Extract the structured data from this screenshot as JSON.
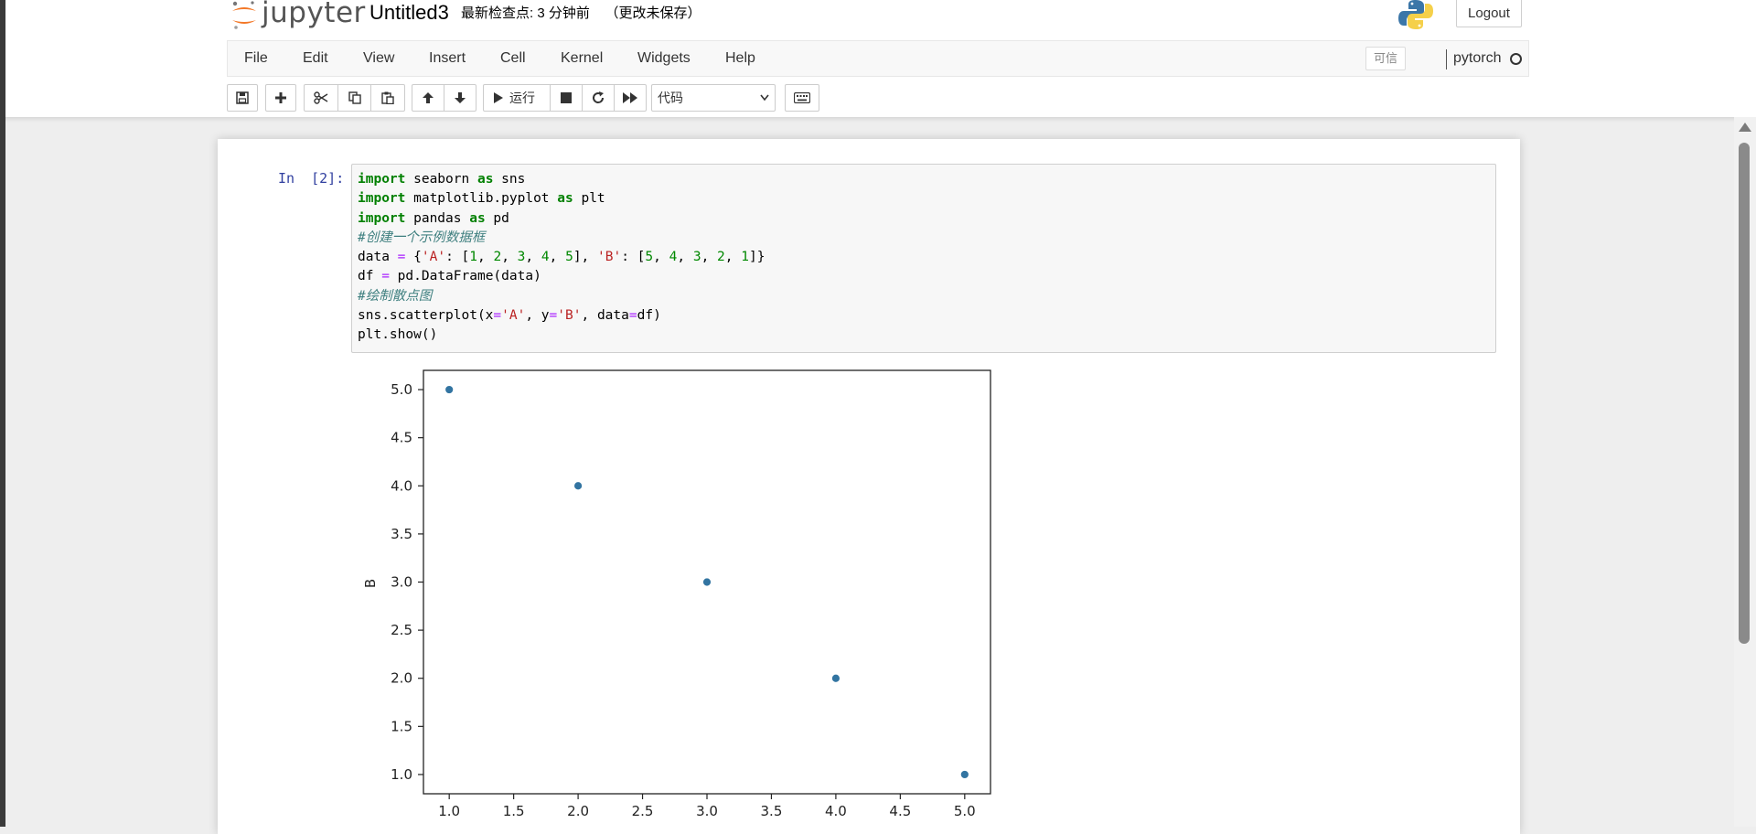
{
  "app": {
    "name": "jupyter",
    "notebook_title": "Untitled3",
    "checkpoint": "最新检查点: 3 分钟前    （更改未保存）",
    "logout_label": "Logout"
  },
  "menu": {
    "items": [
      "File",
      "Edit",
      "View",
      "Insert",
      "Cell",
      "Kernel",
      "Widgets",
      "Help"
    ],
    "trusted_label": "可信",
    "kernel_name": "pytorch"
  },
  "toolbar": {
    "run_label": "运行",
    "cell_type": "代码",
    "icons": [
      "save-icon",
      "plus-icon",
      "cut-icon",
      "copy-icon",
      "paste-icon",
      "arrow-up-icon",
      "arrow-down-icon",
      "play-icon",
      "stop-icon",
      "restart-icon",
      "fast-forward-icon",
      "keyboard-icon"
    ]
  },
  "cell": {
    "prompt": "In  [2]:",
    "code_lines": [
      "import seaborn as sns",
      "import matplotlib.pyplot as plt",
      "import pandas as pd",
      "#创建一个示例数据框",
      "data = {'A': [1, 2, 3, 4, 5], 'B': [5, 4, 3, 2, 1]}",
      "df = pd.DataFrame(data)",
      "#绘制散点图",
      "sns.scatterplot(x='A', y='B', data=df)",
      "plt.show()"
    ]
  },
  "chart_data": {
    "type": "scatter",
    "x": [
      1,
      2,
      3,
      4,
      5
    ],
    "y": [
      5,
      4,
      3,
      2,
      1
    ],
    "xlabel": "",
    "ylabel": "B",
    "xlim": [
      0.8,
      5.2
    ],
    "ylim": [
      0.8,
      5.2
    ],
    "xticks": [
      "1.0",
      "1.5",
      "2.0",
      "2.5",
      "3.0",
      "3.5",
      "4.0",
      "4.5",
      "5.0"
    ],
    "yticks": [
      "1.0",
      "1.5",
      "2.0",
      "2.5",
      "3.0",
      "3.5",
      "4.0",
      "4.5",
      "5.0"
    ],
    "point_color": "#3274a1",
    "grid": false
  },
  "colors": {
    "accent_orange": "#f37726",
    "prompt_blue": "#303f9f",
    "keyword_green": "#008000"
  }
}
